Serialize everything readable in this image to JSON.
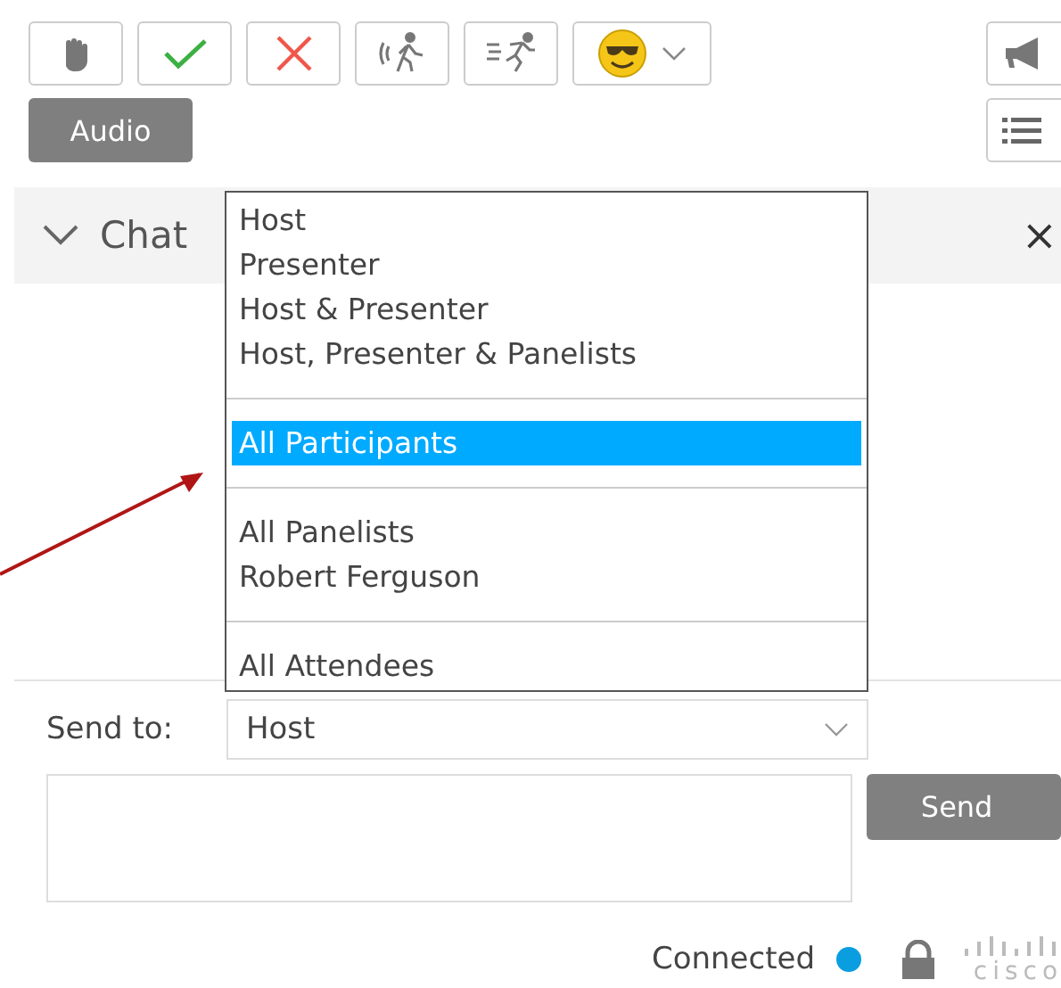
{
  "toolbar": {
    "buttons": [
      {
        "kind": "hand"
      },
      {
        "kind": "check"
      },
      {
        "kind": "cross"
      },
      {
        "kind": "walk"
      },
      {
        "kind": "run"
      },
      {
        "kind": "emoji"
      }
    ],
    "audio_button": "Audio"
  },
  "chat": {
    "title": "Chat",
    "expanded": true,
    "close": "×"
  },
  "recipient_menu": {
    "groups": [
      [
        {
          "label": "Host",
          "selected": false
        },
        {
          "label": "Presenter",
          "selected": false
        },
        {
          "label": "Host & Presenter",
          "selected": false
        },
        {
          "label": "Host, Presenter & Panelists",
          "selected": false
        }
      ],
      [
        {
          "label": "All Participants",
          "selected": true
        }
      ],
      [
        {
          "label": "All Panelists",
          "selected": false
        },
        {
          "label": "Robert Ferguson",
          "selected": false
        }
      ],
      [
        {
          "label": "All Attendees",
          "selected": false
        }
      ]
    ]
  },
  "send_to": {
    "label": "Send to:",
    "value": "Host"
  },
  "message": {
    "send_button": "Send"
  },
  "status": {
    "text": "Connected",
    "logo_text": "cisco"
  }
}
